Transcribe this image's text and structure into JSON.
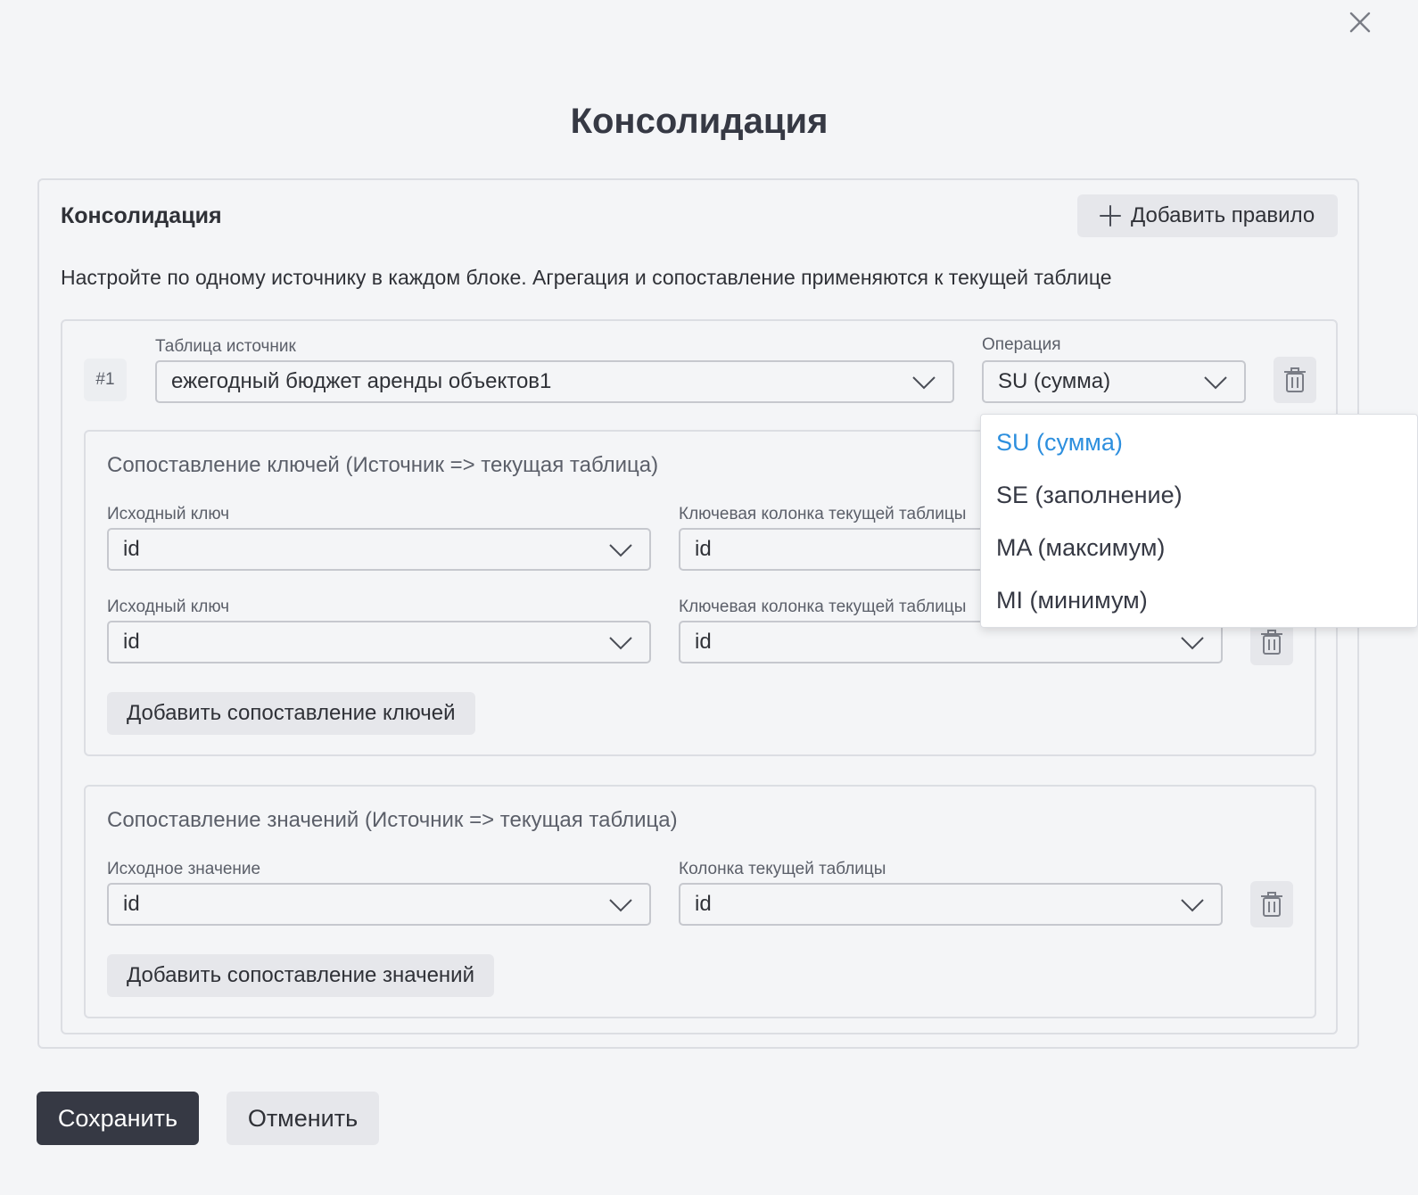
{
  "dialog": {
    "title": "Консолидация"
  },
  "consolidation": {
    "section_title": "Консолидация",
    "add_rule_label": "Добавить правило",
    "description": "Настройте по одному источнику в каждом блоке. Агрегация и сопоставление применяются к текущей таблице"
  },
  "rule": {
    "number": "#1",
    "source_table_label": "Таблица источник",
    "source_table_value": "ежегодный бюджет аренды объектов1",
    "operation_label": "Операция",
    "operation_value": "SU (сумма)"
  },
  "key_mapping": {
    "title": "Сопоставление ключей (Источник => текущая таблица)",
    "rows": [
      {
        "source_label": "Исходный ключ",
        "source_value": "id",
        "target_label": "Ключевая колонка текущей таблицы",
        "target_value": "id"
      },
      {
        "source_label": "Исходный ключ",
        "source_value": "id",
        "target_label": "Ключевая колонка текущей таблицы",
        "target_value": "id"
      }
    ],
    "add_label": "Добавить сопоставление ключей"
  },
  "value_mapping": {
    "title": "Сопоставление значений (Источник => текущая таблица)",
    "rows": [
      {
        "source_label": "Исходное значение",
        "source_value": "id",
        "target_label": "Колонка текущей таблицы",
        "target_value": "id"
      }
    ],
    "add_label": "Добавить сопоставление значений"
  },
  "operation_dropdown": {
    "options": [
      "SU (сумма)",
      "SE (заполнение)",
      "MA (максимум)",
      "MI (минимум)"
    ],
    "selected_index": 0
  },
  "footer": {
    "save_label": "Сохранить",
    "cancel_label": "Отменить"
  },
  "colors": {
    "background": "#f4f5f7",
    "primary_button": "#363944",
    "secondary_button": "#e6e7eb",
    "selected_option": "#2d8fde",
    "border": "#dcdee3"
  }
}
